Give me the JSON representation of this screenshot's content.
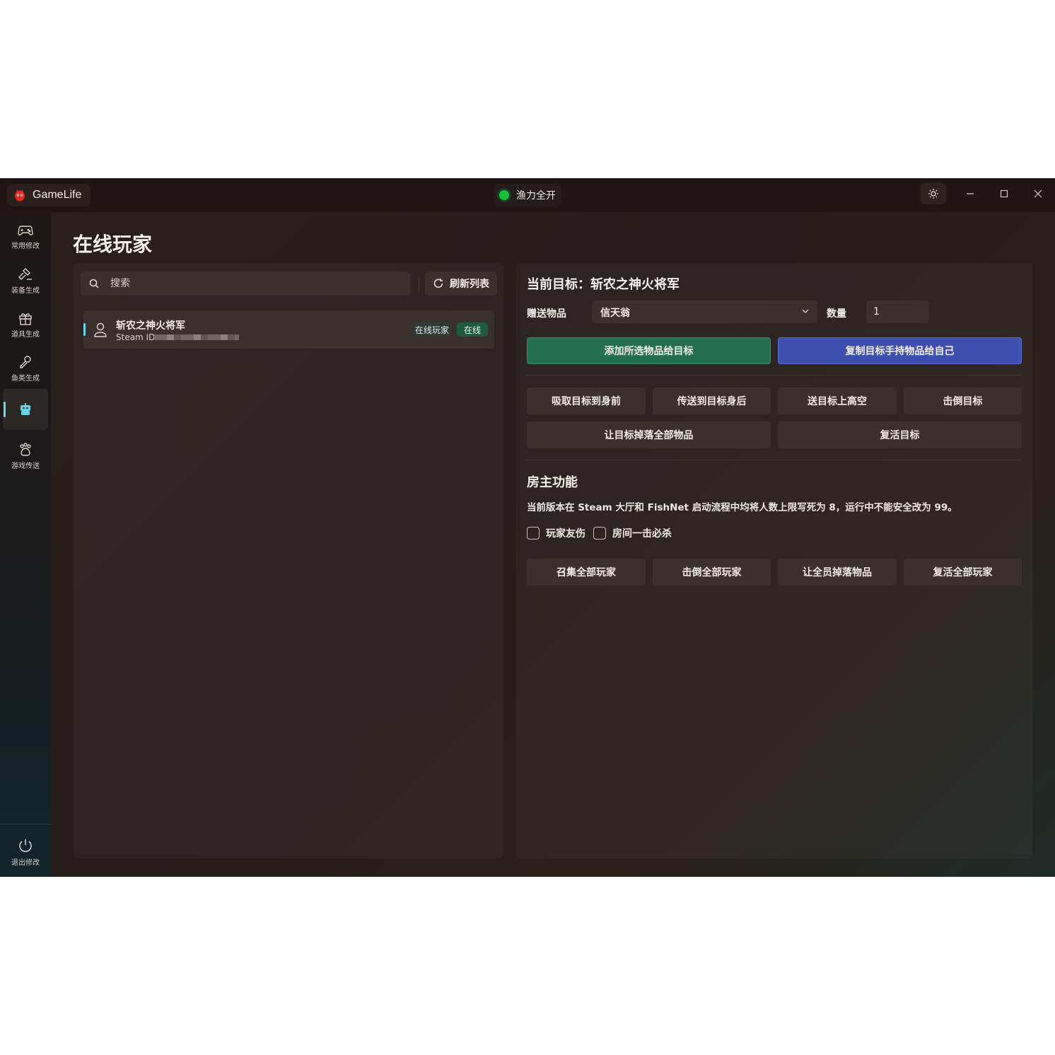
{
  "app": {
    "name": "GameLife",
    "status": "渔力全开",
    "status_color": "#16c23a",
    "accent": "#6ad6e8"
  },
  "sidebar": {
    "items": [
      {
        "label": "常用修改",
        "icon": "gamepad-icon"
      },
      {
        "label": "装备生成",
        "icon": "hammer-icon"
      },
      {
        "label": "道具生成",
        "icon": "gift-icon"
      },
      {
        "label": "鱼类生成",
        "icon": "fish-hook-icon"
      },
      {
        "label": "",
        "icon": "robot-icon",
        "active": true
      },
      {
        "label": "游戏传送",
        "icon": "paw-icon"
      }
    ],
    "exit_label": "退出修改"
  },
  "page": {
    "title": "在线玩家"
  },
  "player_list": {
    "search_placeholder": "搜索",
    "refresh_label": "刷新列表",
    "players": [
      {
        "name": "斩农之神火将军",
        "steam_id_label": "Steam ID",
        "type_tag": "在线玩家",
        "status_tag": "在线"
      }
    ]
  },
  "target": {
    "title": "当前目标：斩农之神火将军",
    "gift_label": "赠送物品",
    "gift_value": "信天翁",
    "qty_label": "数量",
    "qty_value": "1",
    "add_button": "添加所选物品给目标",
    "copy_button": "复制目标手持物品给自己",
    "actions": [
      "吸取目标到身前",
      "传送到目标身后",
      "送目标上高空",
      "击倒目标"
    ],
    "actions2": [
      "让目标掉落全部物品",
      "复活目标"
    ]
  },
  "host": {
    "title": "房主功能",
    "desc": "当前版本在 Steam 大厅和 FishNet 启动流程中均将人数上限写死为 8，运行中不能安全改为 99。",
    "checkbox_friendly_fire": "玩家友伤",
    "checkbox_one_hit": "房间一击必杀",
    "actions": [
      "召集全部玩家",
      "击倒全部玩家",
      "让全员掉落物品",
      "复活全部玩家"
    ]
  }
}
